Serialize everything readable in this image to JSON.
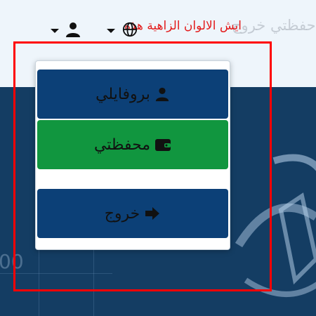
{
  "header": {
    "ghost_title": "حفظتي خروج",
    "red_link": "ايش الالوان الزاهية هذة",
    "language_icon": "globe-icon",
    "account_icon": "user-icon"
  },
  "hero": {
    "partial_text": "00"
  },
  "dropdown": {
    "items": [
      {
        "label": "بروفايلي",
        "icon": "user-icon"
      },
      {
        "label": "محفظتي",
        "icon": "wallet-icon"
      },
      {
        "label": "خروج",
        "icon": "sign-out-icon"
      }
    ]
  },
  "colors": {
    "primary": "#0c4077",
    "success": "#11963f",
    "hero_bg": "#143d63",
    "highlight": "#ff0000",
    "link": "#e31b1b"
  }
}
